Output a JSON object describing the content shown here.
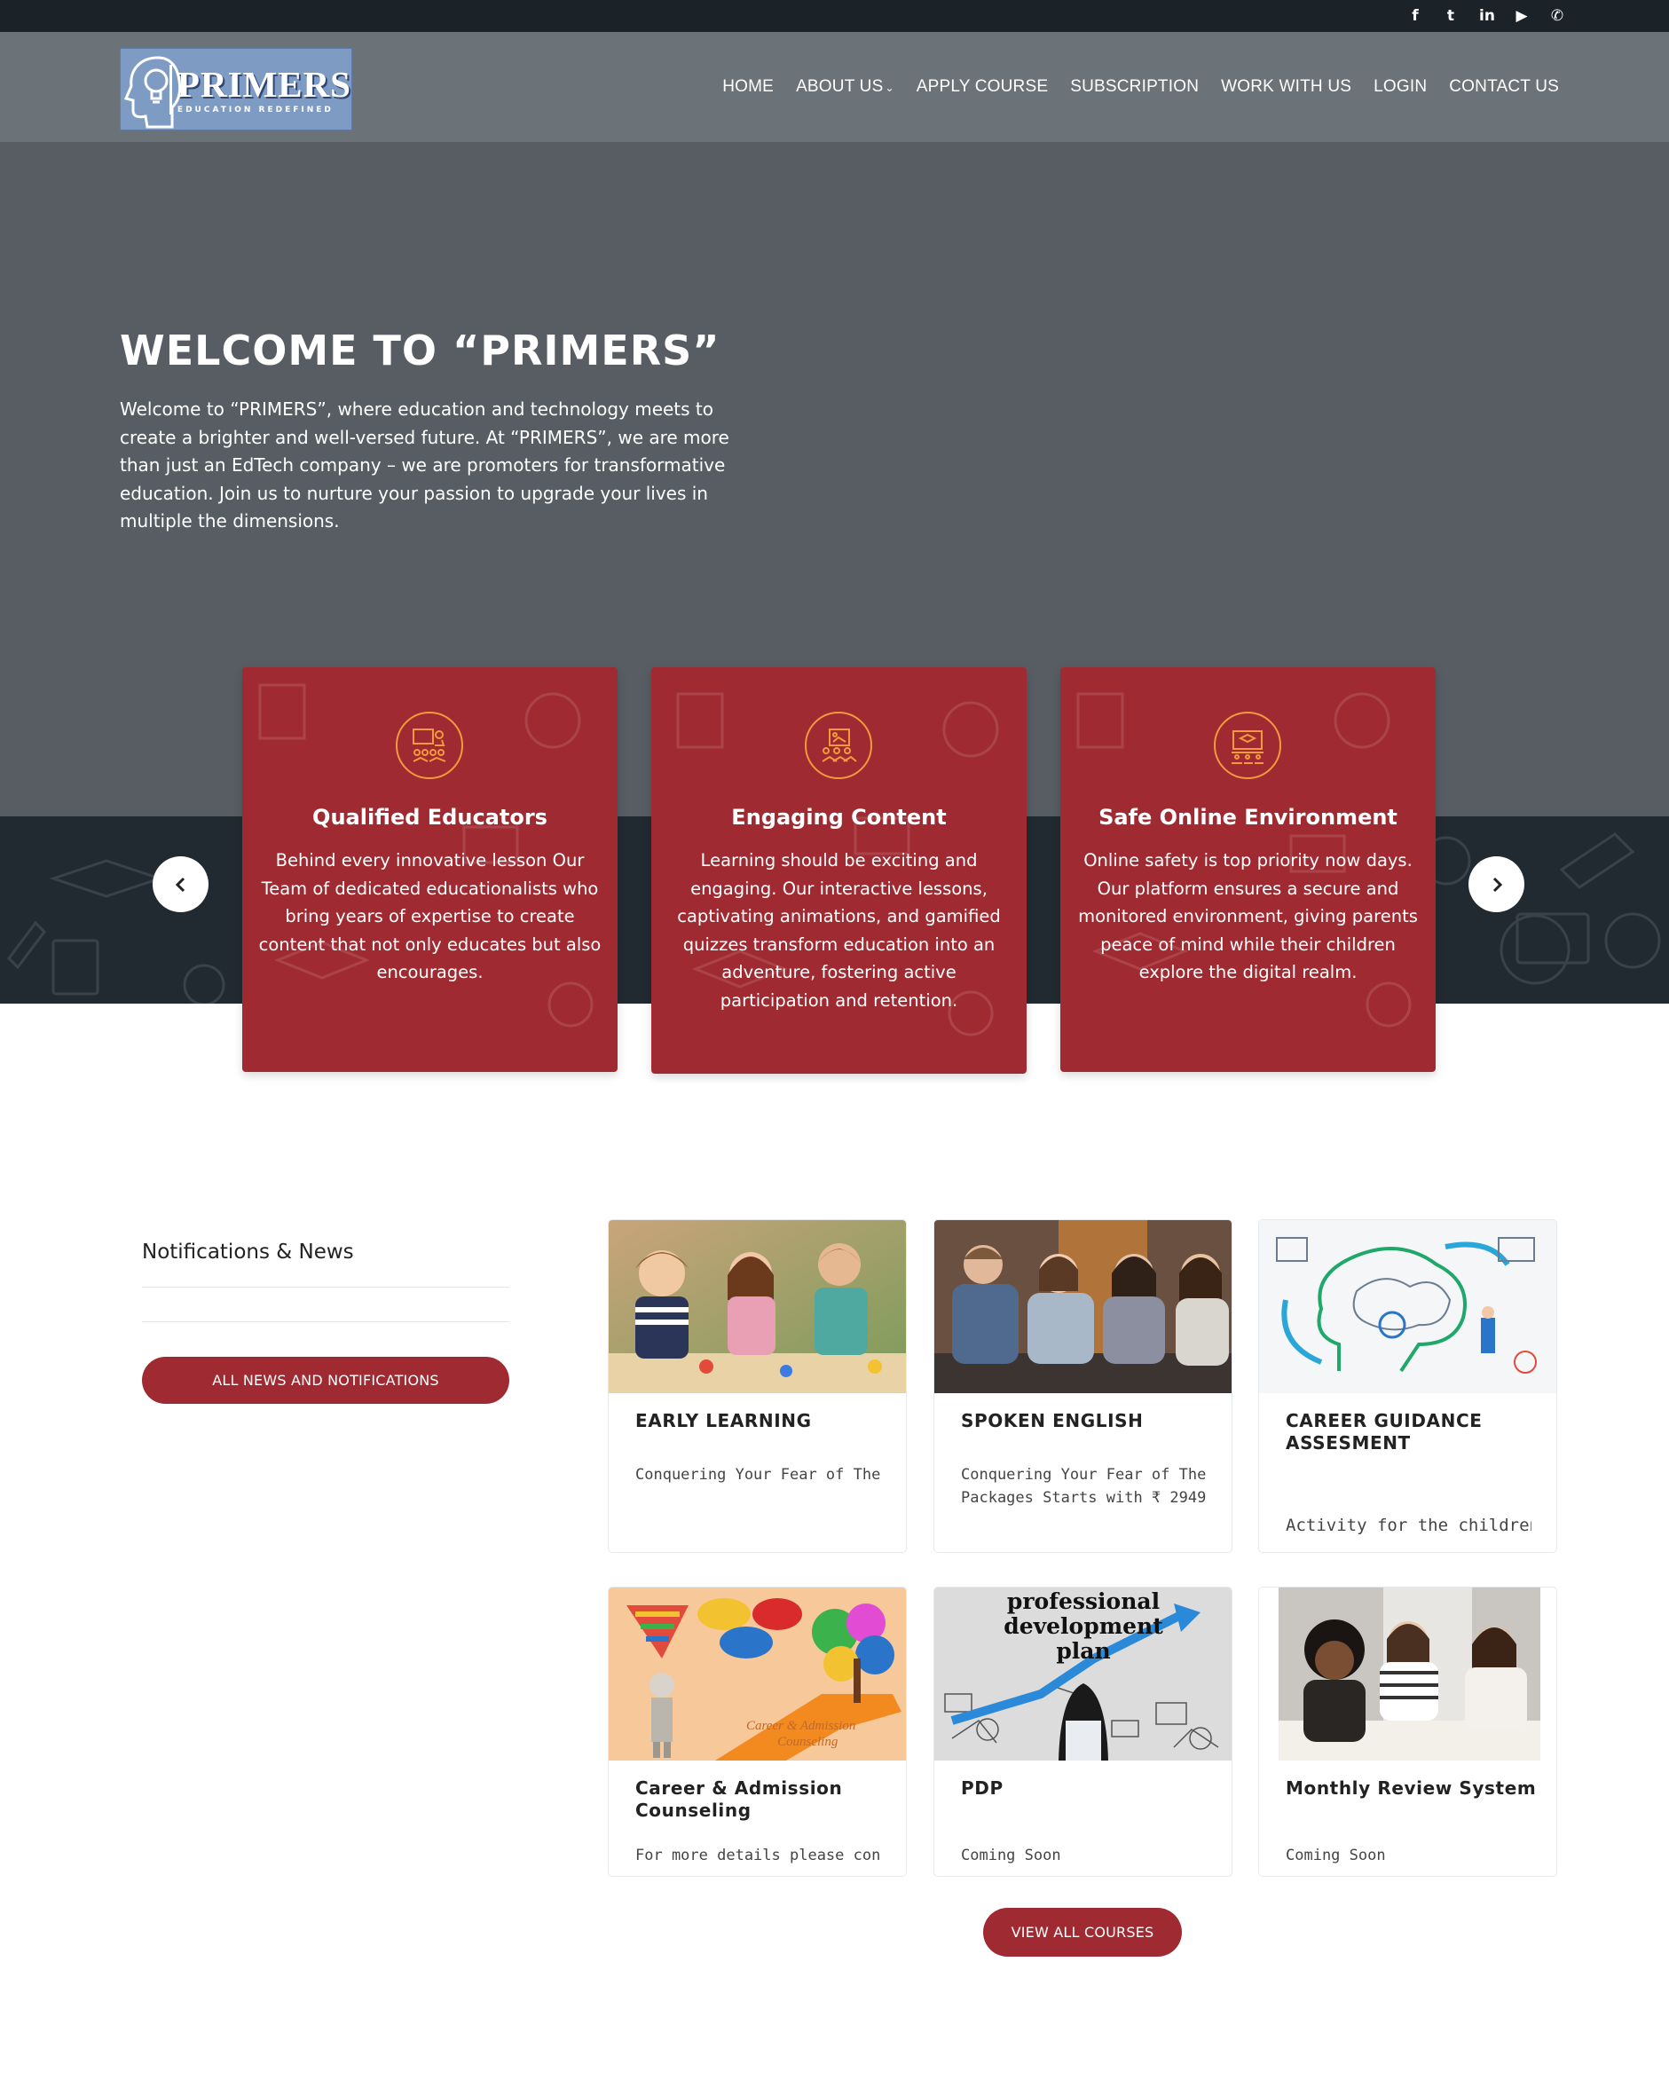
{
  "social": {
    "facebook": "f",
    "twitter": "t",
    "linkedin": "in",
    "youtube": "▶",
    "whatsapp": "✆"
  },
  "logo": {
    "name": "PRIMERS",
    "tagline": "EDUCATION REDEFINED"
  },
  "nav": {
    "home": "HOME",
    "about": "ABOUT US",
    "apply": "APPLY COURSE",
    "subscription": "SUBSCRIPTION",
    "work": "WORK WITH US",
    "login": "LOGIN",
    "contact": "CONTACT US"
  },
  "hero": {
    "title": "WELCOME TO “PRIMERS”",
    "text": "Welcome to “PRIMERS”, where education and technology meets to create a brighter and well-versed future. At “PRIMERS”, we are more than just an EdTech company – we are promoters for transformative education. Join us to nurture your passion to upgrade your lives in multiple the dimensions."
  },
  "features": [
    {
      "title": "Qualified Educators",
      "text": "Behind every innovative lesson Our Team of dedicated educationalists who bring years of expertise to create content that not only educates but also encourages.",
      "icon": "teacher-icon"
    },
    {
      "title": "Engaging Content",
      "text": "Learning should be exciting and engaging. Our interactive lessons, captivating animations, and gamified quizzes transform education into an adventure, fostering active participation and retention.",
      "icon": "content-icon"
    },
    {
      "title": "Safe Online Environment",
      "text": "Online safety is top priority now days. Our platform ensures a secure and monitored environment, giving parents peace of mind while their children explore the digital realm.",
      "icon": "classroom-icon"
    }
  ],
  "news": {
    "title": "Notifications & News",
    "button": "ALL NEWS AND NOTIFICATIONS"
  },
  "courses": [
    {
      "title": "EARLY LEARNING",
      "desc1": "Conquering Your Fear of The E",
      "desc2": ""
    },
    {
      "title": "SPOKEN ENGLISH",
      "desc1": "Conquering Your Fear of The E",
      "desc2": "Packages Starts with ₹ 2949."
    },
    {
      "title": "CAREER GUIDANCE ASSESMENT",
      "desc1": "Activity for the children to",
      "desc2": ""
    },
    {
      "title": "Career & Admission Counseling",
      "desc1": "For more details please conne",
      "desc2": ""
    },
    {
      "title": "PDP",
      "desc1": "Coming Soon",
      "desc2": ""
    },
    {
      "title": "Monthly Review System",
      "desc1": "Coming Soon",
      "desc2": ""
    }
  ],
  "images": {
    "pdp_line1": "professional",
    "pdp_line2": "development",
    "pdp_line3": "plan",
    "career_line1": "Career & Admission",
    "career_line2": "Counseling"
  },
  "courses_button": "VIEW ALL COURSES",
  "colors": {
    "topbar": "#1b2329",
    "header": "#6c7378",
    "hero": "#575d63",
    "band": "#222a31",
    "accent": "#a02a31",
    "icon_ring": "#f29a3d"
  }
}
